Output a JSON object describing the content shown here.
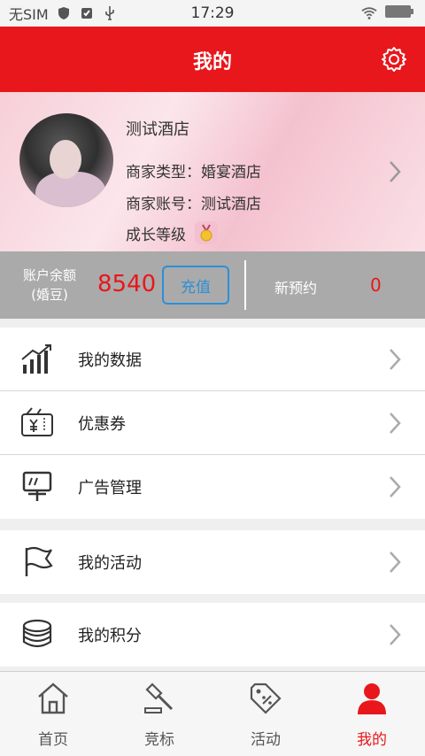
{
  "status_bar": {
    "sim": "无SIM",
    "time": "17:29"
  },
  "header": {
    "title": "我的"
  },
  "profile": {
    "name": "测试酒店",
    "merchant_type": "商家类型：婚宴酒店",
    "merchant_account": "商家账号：测试酒店",
    "growth_level_label": "成长等级"
  },
  "balance": {
    "label_line1": "账户余额",
    "label_line2": "(婚豆)",
    "value": "8540",
    "recharge_label": "充值",
    "new_booking_label": "新预约",
    "new_booking_value": "0"
  },
  "menu": {
    "group1": [
      {
        "label": "我的数据",
        "icon": "bar-chart-icon"
      },
      {
        "label": "优惠券",
        "icon": "coupon-icon"
      },
      {
        "label": "广告管理",
        "icon": "billboard-icon"
      }
    ],
    "group2": [
      {
        "label": "我的活动",
        "icon": "flag-icon"
      }
    ],
    "group3": [
      {
        "label": "我的积分",
        "icon": "coins-icon"
      }
    ]
  },
  "tabs": [
    {
      "label": "首页",
      "icon": "home-icon"
    },
    {
      "label": "竞标",
      "icon": "gavel-icon"
    },
    {
      "label": "活动",
      "icon": "tag-icon"
    },
    {
      "label": "我的",
      "icon": "user-icon",
      "active": true
    }
  ],
  "colors": {
    "brand_red": "#e8171b",
    "accent_blue": "#2b8fd8",
    "balance_bg": "#aaaaaa"
  }
}
